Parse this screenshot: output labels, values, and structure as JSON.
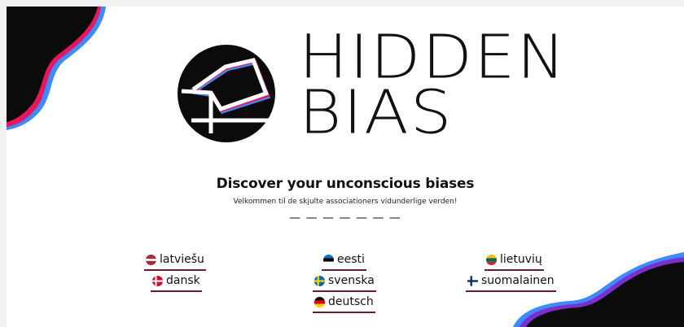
{
  "logo": {
    "line1": "HIDDEN",
    "line2": "BIAS"
  },
  "headline": "Discover your unconscious biases",
  "subline": "Velkommen til de skjulte associationers vidunderlige verden!",
  "divider": "— — — — — — —",
  "languages": [
    {
      "label": "latviešu",
      "icon": "latvia-flag-icon"
    },
    {
      "label": "eesti",
      "icon": "estonia-flag-icon"
    },
    {
      "label": "lietuvių",
      "icon": "lithuania-flag-icon"
    },
    {
      "label": "dansk",
      "icon": "denmark-flag-icon"
    },
    {
      "label": "svenska",
      "icon": "sweden-flag-icon"
    },
    {
      "label": "suomalainen",
      "icon": "finland-flag-icon"
    },
    {
      "label": "deutsch",
      "icon": "germany-flag-icon"
    }
  ],
  "colors": {
    "accent_underline": "#6b1a2a",
    "blob_black": "#0b0b0b",
    "blob_pink": "#e8175d",
    "blob_blue": "#3d8bff",
    "blob_purple": "#7b2fd0"
  }
}
